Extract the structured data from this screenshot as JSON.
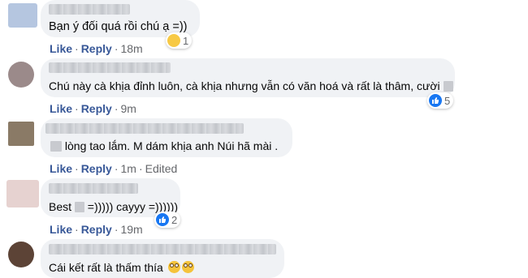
{
  "comments": [
    {
      "text": "Bạn ý đối quá rồi chú ạ =))",
      "like": "Like",
      "reply": "Reply",
      "time": "18m",
      "reaction_count": "1"
    },
    {
      "text": "Chú này cà khịa đỉnh luôn, cà khịa nhưng vẫn có văn hoá và rất là thâm, cười",
      "like": "Like",
      "reply": "Reply",
      "time": "9m",
      "reaction_count": "5"
    },
    {
      "text": "lòng tao lắm. M dám khịa anh Núi hã mài .",
      "like": "Like",
      "reply": "Reply",
      "time": "1m",
      "edited": "Edited"
    },
    {
      "text_a": "Best",
      "text_b": "=))))) cayyy =))))))",
      "like": "Like",
      "reply": "Reply",
      "time": "19m",
      "reaction_count": "2"
    },
    {
      "text": "Cái kết rất là thấm thía"
    }
  ],
  "icons": {
    "like": "like-icon",
    "haha": "haha-icon",
    "grimace": "grimacing-face-icon"
  },
  "colors": {
    "bubble": "#f0f2f5",
    "action_link": "#385898",
    "meta": "#65676b",
    "like_blue": "#1877f2"
  }
}
